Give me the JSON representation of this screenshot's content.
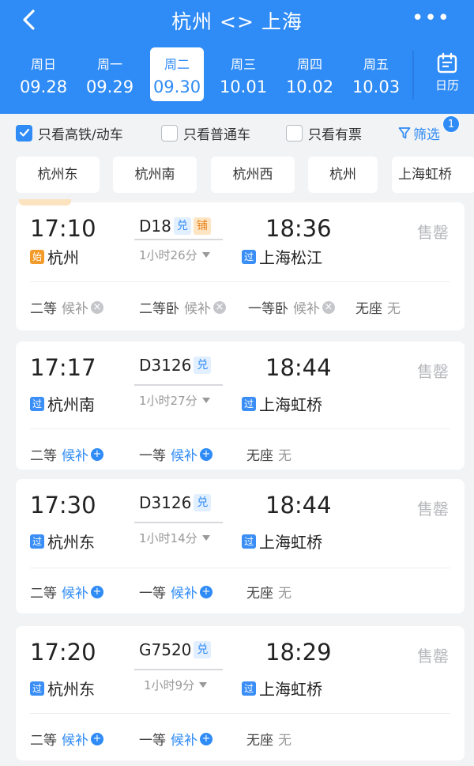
{
  "header": {
    "title": "杭州 <> 上海",
    "more": "•••",
    "dates": [
      {
        "dow": "周日",
        "date": "09.28",
        "active": false
      },
      {
        "dow": "周一",
        "date": "09.29",
        "active": false
      },
      {
        "dow": "周二",
        "date": "09.30",
        "active": true
      },
      {
        "dow": "周三",
        "date": "10.01",
        "active": false
      },
      {
        "dow": "周四",
        "date": "10.02",
        "active": false
      },
      {
        "dow": "周五",
        "date": "10.03",
        "active": false
      }
    ],
    "calendar_label": "日历"
  },
  "filters": {
    "high_speed": {
      "label": "只看高铁/动车",
      "checked": true
    },
    "normal": {
      "label": "只看普通车",
      "checked": false
    },
    "has_ticket": {
      "label": "只看有票",
      "checked": false
    },
    "filter_label": "筛选",
    "filter_badge": "1"
  },
  "stations": [
    "杭州东",
    "杭州南",
    "杭州西",
    "杭州",
    "上海虹桥"
  ],
  "trains": [
    {
      "dep_time": "17:10",
      "arr_time": "18:36",
      "dep_badge": "始",
      "dep_station": "杭州",
      "arr_badge": "过",
      "arr_station": "上海松江",
      "train_no": "D18",
      "tags": [
        "兑",
        "铺"
      ],
      "duration": "1小时26分",
      "status": "售罄",
      "seats": [
        {
          "class": "二等",
          "status": "候补",
          "available": false
        },
        {
          "class": "二等卧",
          "status": "候补",
          "available": false
        },
        {
          "class": "一等卧",
          "status": "候补",
          "available": false
        },
        {
          "class": "无座",
          "status": "无",
          "available": false
        }
      ]
    },
    {
      "dep_time": "17:17",
      "arr_time": "18:44",
      "dep_badge": "过",
      "dep_station": "杭州南",
      "arr_badge": "过",
      "arr_station": "上海虹桥",
      "train_no": "D3126",
      "tags": [
        "兑"
      ],
      "duration": "1小时27分",
      "status": "售罄",
      "seats": [
        {
          "class": "二等",
          "status": "候补",
          "available": true
        },
        {
          "class": "一等",
          "status": "候补",
          "available": true
        },
        {
          "class": "无座",
          "status": "无",
          "available": false
        }
      ]
    },
    {
      "dep_time": "17:30",
      "arr_time": "18:44",
      "dep_badge": "过",
      "dep_station": "杭州东",
      "arr_badge": "过",
      "arr_station": "上海虹桥",
      "train_no": "D3126",
      "tags": [
        "兑"
      ],
      "duration": "1小时14分",
      "status": "售罄",
      "seats": [
        {
          "class": "二等",
          "status": "候补",
          "available": true
        },
        {
          "class": "一等",
          "status": "候补",
          "available": true
        },
        {
          "class": "无座",
          "status": "无",
          "available": false
        }
      ]
    },
    {
      "dep_time": "17:20",
      "arr_time": "18:29",
      "dep_badge": "过",
      "dep_station": "杭州东",
      "arr_badge": "过",
      "arr_station": "上海虹桥",
      "train_no": "G7520",
      "tags": [
        "兑"
      ],
      "duration": "1小时9分",
      "status": "售罄",
      "seats": [
        {
          "class": "二等",
          "status": "候补",
          "available": true
        },
        {
          "class": "一等",
          "status": "候补",
          "available": true
        },
        {
          "class": "无座",
          "status": "无",
          "available": false
        }
      ]
    }
  ],
  "colors": {
    "primary": "#2f8bf5",
    "orange": "#f39b2a",
    "muted": "#b6b8bc"
  }
}
